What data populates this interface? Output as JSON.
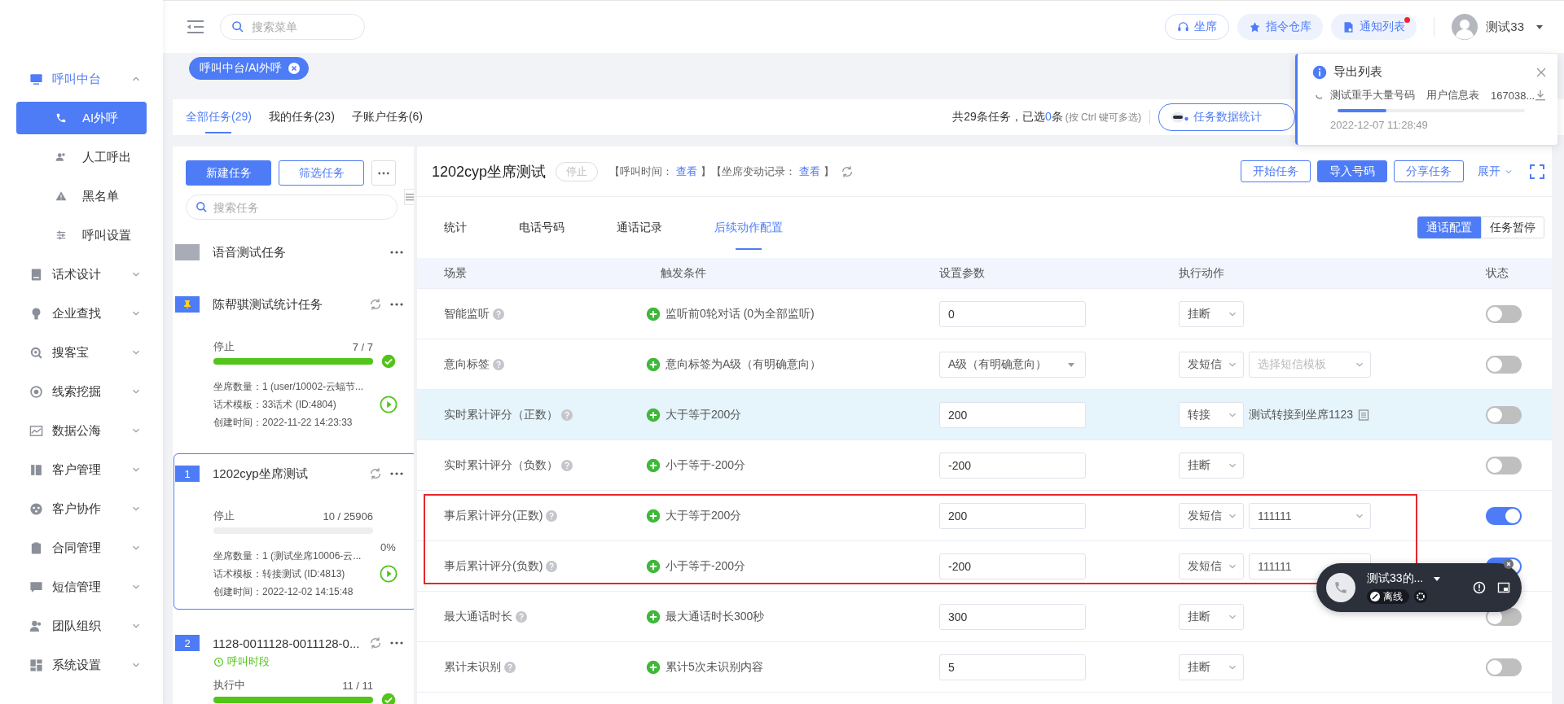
{
  "sidebar": {
    "items": [
      {
        "label": "呼叫中台",
        "expanded": true,
        "children": [
          {
            "label": "AI外呼",
            "selected": true
          },
          {
            "label": "人工呼出",
            "selected": false
          },
          {
            "label": "黑名单",
            "selected": false
          },
          {
            "label": "呼叫设置",
            "selected": false
          }
        ]
      },
      {
        "label": "话术设计",
        "expanded": false
      },
      {
        "label": "企业查找",
        "expanded": false
      },
      {
        "label": "搜客宝",
        "expanded": false
      },
      {
        "label": "线索挖掘",
        "expanded": false
      },
      {
        "label": "数据公海",
        "expanded": false
      },
      {
        "label": "客户管理",
        "expanded": false
      },
      {
        "label": "客户协作",
        "expanded": false
      },
      {
        "label": "合同管理",
        "expanded": false
      },
      {
        "label": "短信管理",
        "expanded": false
      },
      {
        "label": "团队组织",
        "expanded": false
      },
      {
        "label": "系统设置",
        "expanded": false
      }
    ]
  },
  "topbar": {
    "search": {
      "placeholder": "搜索菜单"
    },
    "buttons": [
      {
        "label": "坐席",
        "kind": "outline",
        "unread": false
      },
      {
        "label": "指令仓库",
        "kind": "soft",
        "unread": false
      },
      {
        "label": "通知列表",
        "kind": "soft",
        "unread": true
      }
    ],
    "user": {
      "name": "测试33"
    }
  },
  "tags": [
    {
      "label": "呼叫中台/AI外呼",
      "selected": true
    }
  ],
  "task_tabs": [
    {
      "label": "全部任务(29)",
      "selected": true
    },
    {
      "label": "我的任务(23)",
      "selected": false
    },
    {
      "label": "子账户任务(6)",
      "selected": false
    }
  ],
  "summary": {
    "prefix": "共29条任务，已选",
    "count": "0",
    "suffix": "条",
    "hint": "(按 Ctrl 键可多选)"
  },
  "stats_button": {
    "label": "任务数据统计"
  },
  "task_list": {
    "buttons": [
      {
        "label": "新建任务",
        "primary": true
      },
      {
        "label": "筛选任务",
        "primary": false
      }
    ],
    "search": {
      "placeholder": "搜索任务"
    },
    "tasks": [
      {
        "kind": "plain",
        "title": "语音测试任务",
        "selected": false,
        "sync": false
      },
      {
        "kind": "pinned",
        "title": "陈帮骐测试统计任务",
        "selected": false,
        "sync": true,
        "status": "停止",
        "count": "7 / 7",
        "level": 1,
        "completed": true,
        "details": [
          "坐席数量：1 (user/10002-云蝠节...",
          "话术模板：33话术 (ID:4804)",
          "创建时间：2022-11-22 14:23:33"
        ]
      },
      {
        "kind": "number",
        "badge": "1",
        "title": "1202cyp坐席测试",
        "selected": true,
        "sync": true,
        "status": "停止",
        "count": "10 / 25906",
        "level": 0,
        "completed": false,
        "percent": "0%",
        "details": [
          "坐席数量：1 (测试坐席10006-云...",
          "话术模板：转接测试 (ID:4813)",
          "创建时间：2022-12-02 14:15:48"
        ]
      },
      {
        "kind": "number",
        "badge": "2",
        "title": "1128-0011128-0011128-0...",
        "selected": false,
        "sync": true,
        "schedule": "呼叫时段",
        "status": "执行中",
        "count": "11 / 11",
        "level": 1,
        "completed": true
      }
    ]
  },
  "task_detail": {
    "title": "1202cyp坐席测试",
    "status": "停止",
    "meta": [
      {
        "label": "【呼叫时间：",
        "link": "查看"
      },
      {
        "label": "】【坐席变动记录：",
        "link": "查看"
      }
    ],
    "meta_end": "】",
    "actions": [
      {
        "label": "开始任务",
        "primary": false
      },
      {
        "label": "导入号码",
        "primary": true
      },
      {
        "label": "分享任务",
        "primary": false
      }
    ],
    "expand": "展开",
    "tabs": [
      {
        "label": "统计",
        "selected": false
      },
      {
        "label": "电话号码",
        "selected": false
      },
      {
        "label": "通话记录",
        "selected": false
      },
      {
        "label": "后续动作配置",
        "selected": true
      }
    ],
    "modes": [
      {
        "label": "通话配置",
        "selected": true
      },
      {
        "label": "任务暂停",
        "selected": false
      }
    ],
    "table": {
      "columns": [
        "场景",
        "触发条件",
        "设置参数",
        "执行动作",
        "状态"
      ],
      "rows": [
        {
          "scene": "智能监听",
          "trigger": "监听前0轮对话 (0为全部监听)",
          "param": {
            "kind": "input",
            "value": "0"
          },
          "action": "挂断",
          "highlighted": false,
          "on": false
        },
        {
          "scene": "意向标签",
          "trigger": "意向标签为A级（有明确意向）",
          "param": {
            "kind": "dropdown",
            "value": "A级（有明确意向）"
          },
          "action": "发短信",
          "extra": {
            "kind": "select",
            "placeholder": "选择短信模板",
            "chevron": true
          },
          "highlighted": false,
          "on": false
        },
        {
          "scene": "实时累计评分（正数）",
          "trigger": "大于等于200分",
          "param": {
            "kind": "input",
            "value": "200"
          },
          "action": "转接",
          "extra": {
            "kind": "text",
            "value": "测试转接到坐席1123"
          },
          "highlighted": true,
          "on": false
        },
        {
          "scene": "实时累计评分（负数）",
          "trigger": "小于等于-200分",
          "param": {
            "kind": "input",
            "value": "-200"
          },
          "action": "挂断",
          "highlighted": false,
          "on": false
        },
        {
          "scene": "事后累计评分(正数)",
          "trigger": "大于等于200分",
          "param": {
            "kind": "input",
            "value": "200"
          },
          "action": "发短信",
          "extra": {
            "kind": "select",
            "value": "111111",
            "chevron": true
          },
          "highlighted": false,
          "on": true
        },
        {
          "scene": "事后累计评分(负数)",
          "trigger": "小于等于-200分",
          "param": {
            "kind": "input",
            "value": "-200"
          },
          "action": "发短信",
          "extra": {
            "kind": "select",
            "value": "111111",
            "chevron": false
          },
          "highlighted": false,
          "on": true
        },
        {
          "scene": "最大通话时长",
          "trigger": "最大通话时长300秒",
          "param": {
            "kind": "input",
            "value": "300"
          },
          "action": "挂断",
          "highlighted": false,
          "on": false
        },
        {
          "scene": "累计未识别",
          "trigger": "累计5次未识别内容",
          "param": {
            "kind": "input",
            "value": "5"
          },
          "action": "挂断",
          "highlighted": false,
          "on": false
        }
      ]
    }
  },
  "export_popover": {
    "title": "导出列表",
    "items": [
      {
        "name": "测试重手大量号码",
        "table": "用户信息表",
        "file": "167038...",
        "level": 0.26
      }
    ],
    "time": "2022-12-07 11:28:49"
  },
  "call_widget": {
    "name": "测试33的...",
    "status": "离线"
  }
}
